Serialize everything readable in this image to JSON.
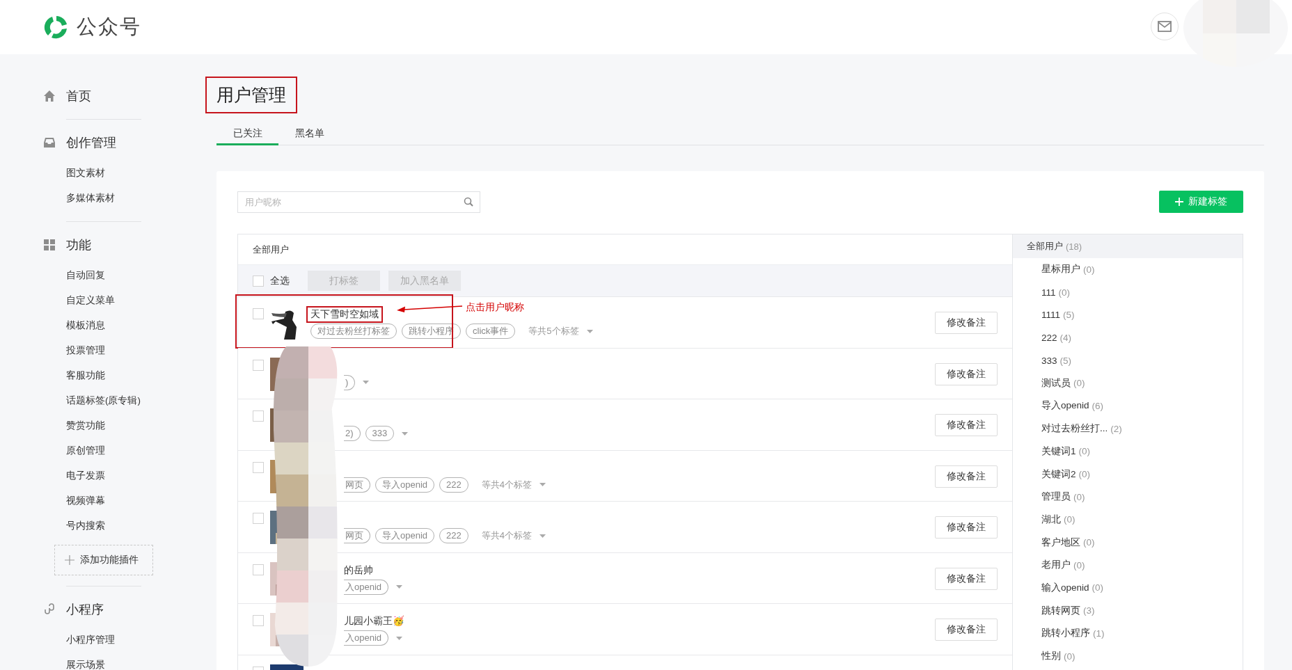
{
  "header": {
    "logo_text": "公众号"
  },
  "sidebar": [
    {
      "title": "首页"
    },
    {
      "title": "创作管理",
      "items": [
        "图文素材",
        "多媒体素材"
      ]
    },
    {
      "title": "功能",
      "items": [
        "自动回复",
        "自定义菜单",
        "模板消息",
        "投票管理",
        "客服功能",
        "话题标签(原专辑)",
        "赞赏功能",
        "原创管理",
        "电子发票",
        "视频弹幕",
        "号内搜索"
      ],
      "add_button": "添加功能插件"
    },
    {
      "title": "小程序",
      "items": [
        "小程序管理",
        "展示场景"
      ]
    }
  ],
  "page_title": "用户管理",
  "tabs": [
    {
      "label": "已关注",
      "selected": true
    },
    {
      "label": "黑名单",
      "selected": false
    }
  ],
  "search": {
    "placeholder": "用户昵称"
  },
  "new_tag_button": "新建标签",
  "user_list": {
    "header": "全部用户",
    "select_all": {
      "label": "全选",
      "checked": false
    },
    "batch_buttons": [
      {
        "label": "打标签",
        "disabled": true
      },
      {
        "label": "加入黑名单",
        "disabled": true
      }
    ],
    "rows": [
      {
        "checked": false,
        "obscured": false,
        "name": "天下雪时空如域",
        "tags": [
          {
            "text": "对过去粉丝打标签",
            "cut": false
          },
          {
            "text": "跳转小程序",
            "cut": false
          },
          {
            "text": "click事件",
            "cut": false
          }
        ],
        "more": "等共5个标签",
        "remark_button": "修改备注",
        "callout": "点击用户昵称"
      },
      {
        "checked": false,
        "obscured": true,
        "tags": [
          {
            "text": ")",
            "cut": true
          }
        ],
        "remark_button": "修改备注"
      },
      {
        "checked": false,
        "obscured": true,
        "tags": [
          {
            "text": "2)",
            "cut": true
          },
          {
            "text": "333",
            "cut": false
          }
        ],
        "remark_button": "修改备注"
      },
      {
        "checked": false,
        "obscured": true,
        "tags": [
          {
            "text": "网页",
            "cut": true
          },
          {
            "text": "导入openid",
            "cut": false
          },
          {
            "text": "222",
            "cut": false
          }
        ],
        "more": "等共4个标签",
        "remark_button": "修改备注"
      },
      {
        "checked": false,
        "obscured": true,
        "tags": [
          {
            "text": "网页",
            "cut": true
          },
          {
            "text": "导入openid",
            "cut": false
          },
          {
            "text": "222",
            "cut": false
          }
        ],
        "more": "等共4个标签",
        "remark_button": "修改备注"
      },
      {
        "checked": false,
        "obscured": true,
        "name": "的岳帅",
        "tags": [
          {
            "text": "入openid",
            "cut": true
          }
        ],
        "remark_button": "修改备注"
      },
      {
        "checked": false,
        "obscured": true,
        "name": "儿园小霸王🥳",
        "tags": [
          {
            "text": "入openid",
            "cut": true
          }
        ],
        "remark_button": "修改备注"
      },
      {
        "checked": false
      }
    ]
  },
  "tag_panel": {
    "all": {
      "label": "全部用户",
      "count": "(18)",
      "selected": true
    },
    "tags": [
      {
        "label": "星标用户",
        "count": "(0)"
      },
      {
        "label": "111",
        "count": "(0)"
      },
      {
        "label": "1111",
        "count": "(5)"
      },
      {
        "label": "222",
        "count": "(4)"
      },
      {
        "label": "333",
        "count": "(5)"
      },
      {
        "label": "测试员",
        "count": "(0)"
      },
      {
        "label": "导入openid",
        "count": "(6)"
      },
      {
        "label": "对过去粉丝打...",
        "count": "(2)"
      },
      {
        "label": "关键词1",
        "count": "(0)"
      },
      {
        "label": "关键词2",
        "count": "(0)"
      },
      {
        "label": "管理员",
        "count": "(0)"
      },
      {
        "label": "湖北",
        "count": "(0)"
      },
      {
        "label": "客户地区",
        "count": "(0)"
      },
      {
        "label": "老用户",
        "count": "(0)"
      },
      {
        "label": "输入openid",
        "count": "(0)"
      },
      {
        "label": "跳转网页",
        "count": "(3)"
      },
      {
        "label": "跳转小程序",
        "count": "(1)"
      },
      {
        "label": "性别",
        "count": "(0)"
      }
    ]
  }
}
